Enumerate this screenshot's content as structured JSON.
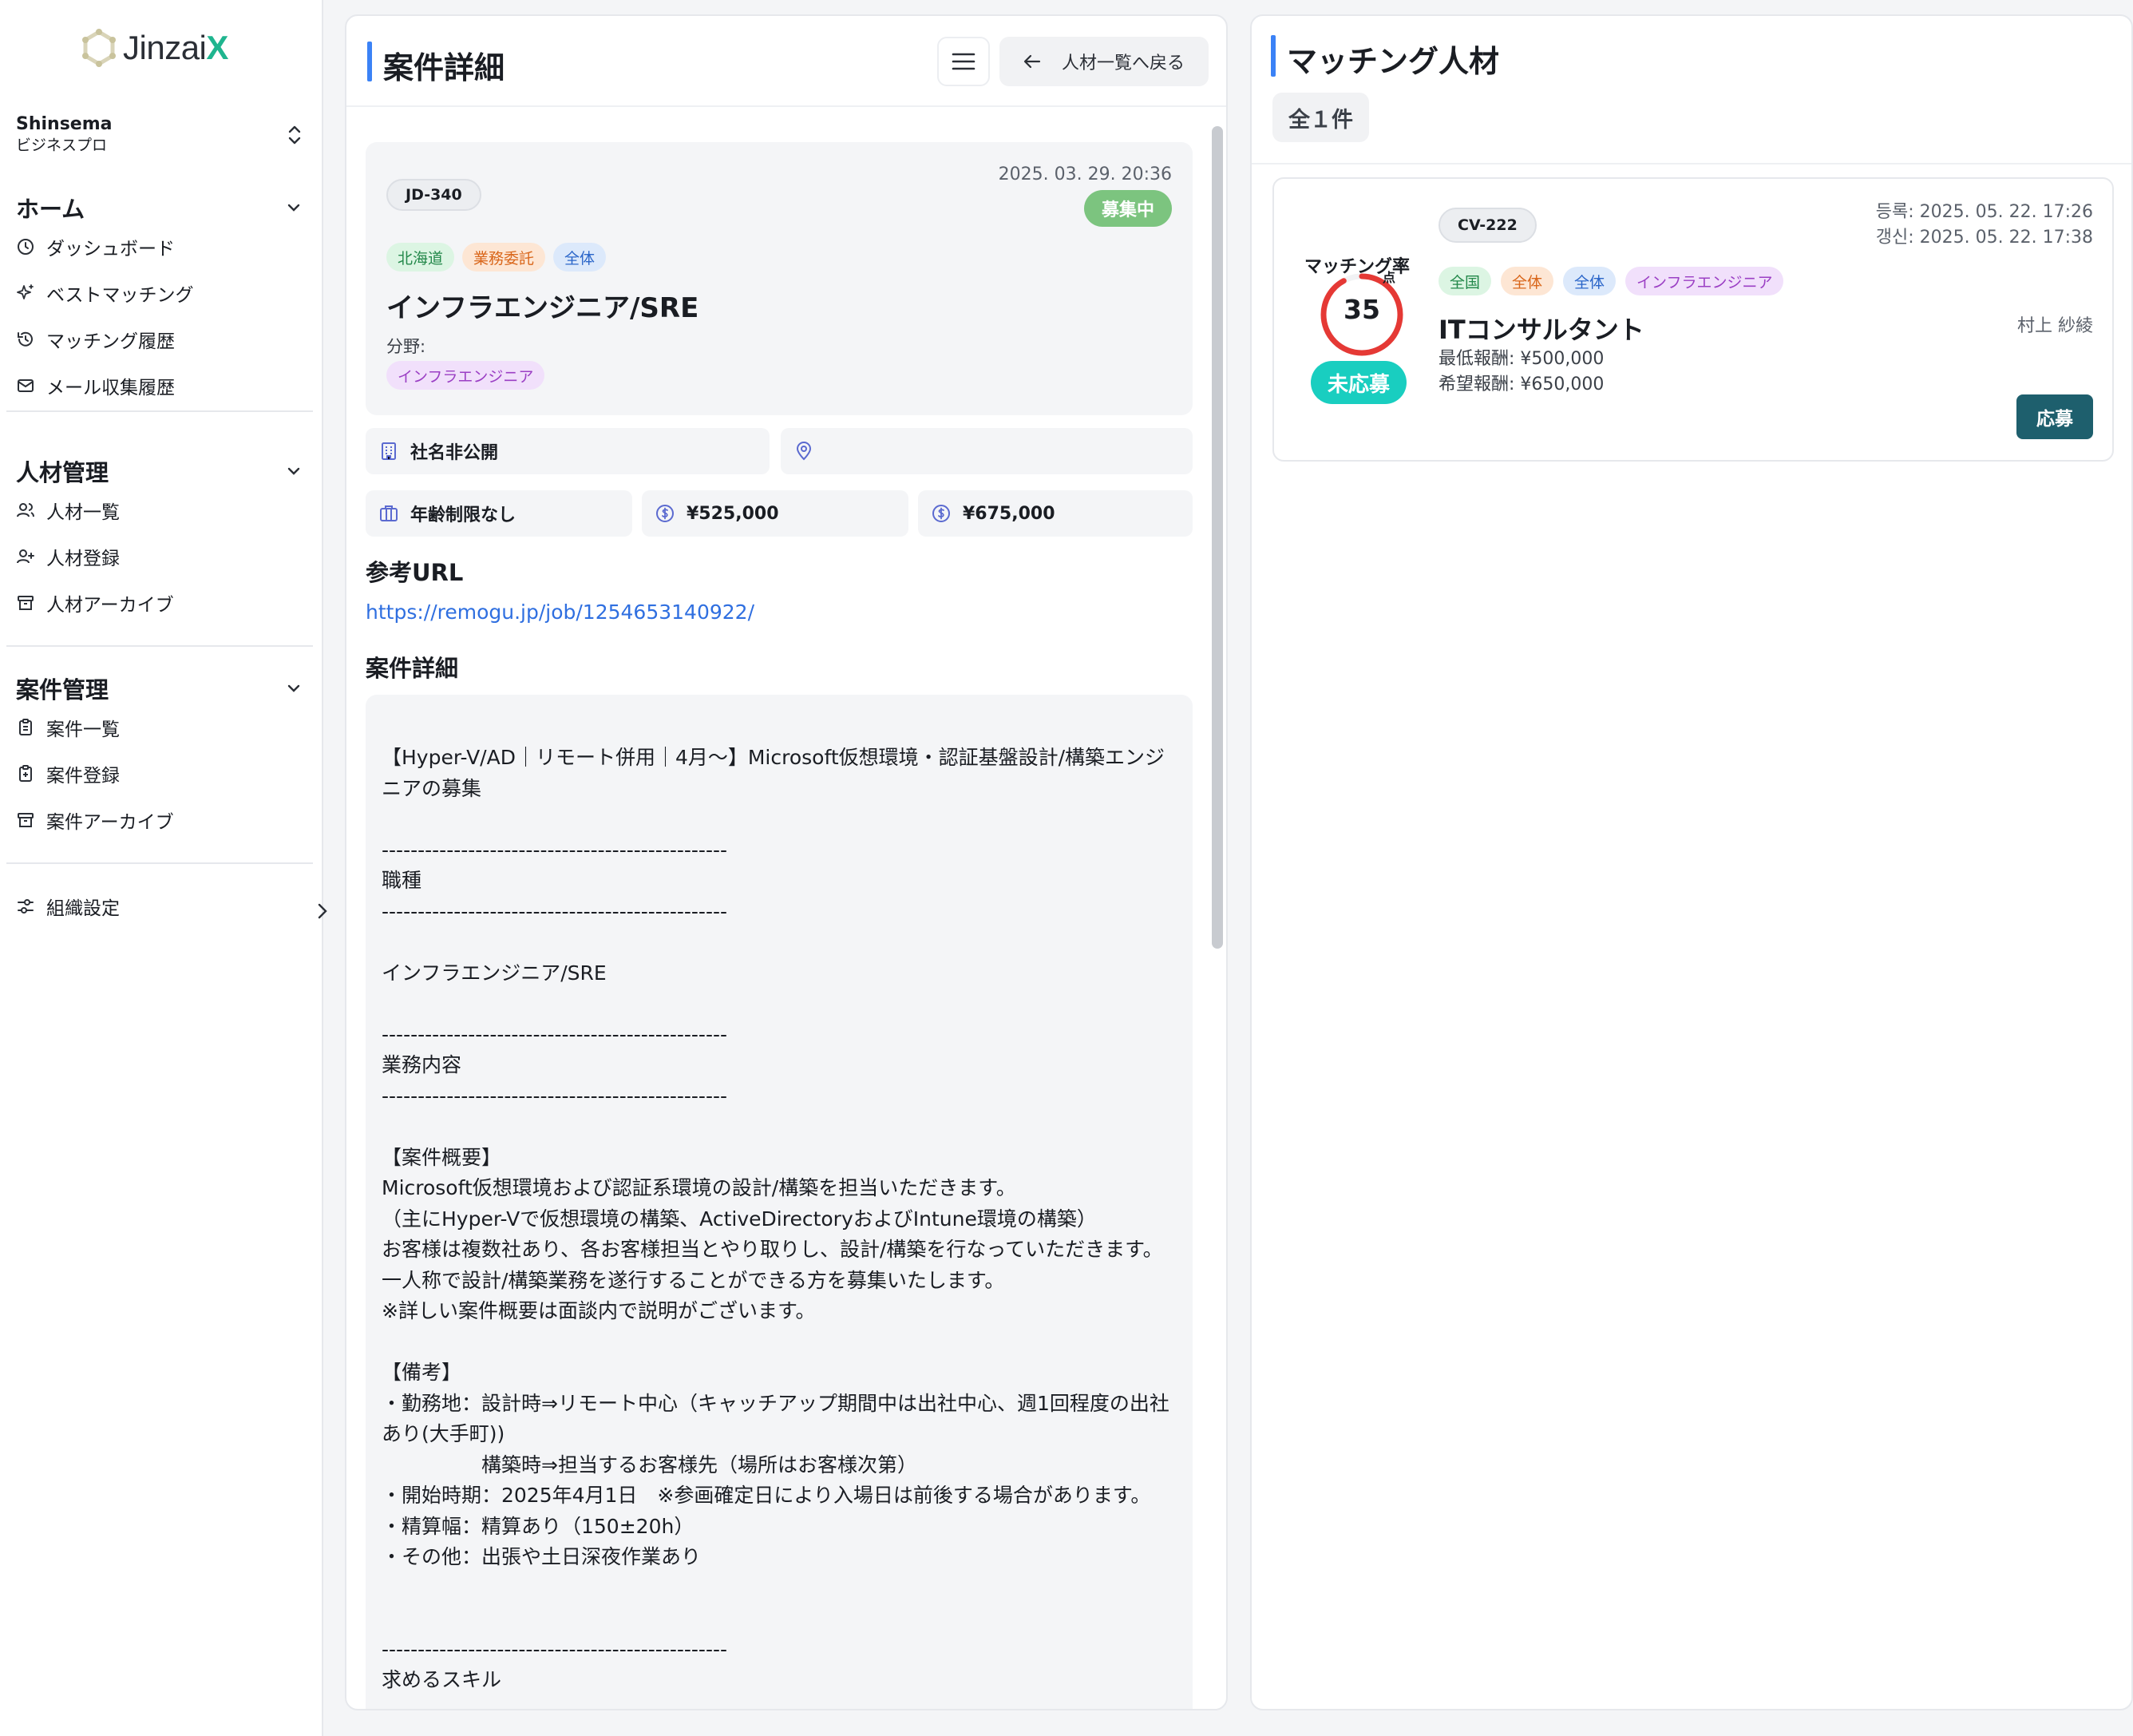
{
  "brand": {
    "name_main": "Jinzai",
    "name_accent": "X"
  },
  "org": {
    "name": "Shinsema",
    "plan": "ビジネスプロ"
  },
  "nav": {
    "home": {
      "label": "ホーム",
      "items": [
        {
          "label": "ダッシュボード",
          "icon": "clock-icon"
        },
        {
          "label": "ベストマッチング",
          "icon": "sparkles-icon"
        },
        {
          "label": "マッチング履歴",
          "icon": "history-icon"
        },
        {
          "label": "メール収集履歴",
          "icon": "mail-icon"
        }
      ]
    },
    "talent": {
      "label": "人材管理",
      "items": [
        {
          "label": "人材一覧",
          "icon": "users-icon"
        },
        {
          "label": "人材登録",
          "icon": "user-plus-icon"
        },
        {
          "label": "人材アーカイブ",
          "icon": "archive-icon"
        }
      ]
    },
    "projects": {
      "label": "案件管理",
      "items": [
        {
          "label": "案件一覧",
          "icon": "clipboard-list-icon"
        },
        {
          "label": "案件登録",
          "icon": "clipboard-plus-icon"
        },
        {
          "label": "案件アーカイブ",
          "icon": "archive-icon"
        }
      ]
    },
    "settings": {
      "label": "組織設定",
      "icon": "sliders-icon"
    }
  },
  "detail": {
    "title": "案件詳細",
    "back_label": "人材一覧へ戻る",
    "job": {
      "code": "JD-340",
      "date": "2025. 03. 29. 20:36",
      "status": "募集中",
      "tags": [
        "北海道",
        "業務委託",
        "全体"
      ],
      "title": "インフラエンジニア/SRE",
      "field_label": "分野:",
      "field_value": "インフラエンジニア"
    },
    "company": "社名非公開",
    "location": "",
    "age": "年齢制限なし",
    "salary_min": "¥525,000",
    "salary_max": "¥675,000",
    "ref_url_title": "参考URL",
    "ref_url": "https://remogu.jp/job/1254653140922/",
    "desc_title": "案件詳細",
    "description": "【Hyper-V/AD｜リモート併用｜4月〜】Microsoft仮想環境・認証基盤設計/構築エンジニアの募集\n\n------------------------------------------------\n職種\n------------------------------------------------\n\nインフラエンジニア/SRE\n\n------------------------------------------------\n業務内容\n------------------------------------------------\n\n【案件概要】\nMicrosoft仮想環境および認証系環境の設計/構築を担当いただきます。\n（主にHyper-Vで仮想環境の構築、ActiveDirectoryおよびIntune環境の構築）\nお客様は複数社あり、各お客様担当とやり取りし、設計/構築を行なっていただきます。\n一人称で設計/構築業務を遂行することができる方を募集いたします。\n※詳しい案件概要は面談内で説明がございます。\n\n【備考】\n・勤務地：設計時⇒リモート中心（キャッチアップ期間中は出社中心、週1回程度の出社あり(大手町))\n　　　　　構築時⇒担当するお客様先（場所はお客様次第）\n・開始時期：2025年4月1日　※参画確定日により入場日は前後する場合があります。\n・精算幅：精算あり（150±20h）\n・その他：出張や土日深夜作業あり\n\n\n------------------------------------------------\n求めるスキル"
  },
  "matching": {
    "title": "マッチング人材",
    "count_label": "全１件",
    "card": {
      "rate_label": "マッチング率",
      "rate": 35,
      "rate_unit": "点",
      "status": "未応募",
      "code": "CV-222",
      "registered": "등록: 2025. 05. 22. 17:26",
      "updated": "갱신: 2025. 05. 22. 17:38",
      "tags": [
        "全国",
        "全体",
        "全体",
        "インフラエンジニア"
      ],
      "title": "ITコンサルタント",
      "person": "村上 紗綾",
      "min_pay": "最低報酬: ¥500,000",
      "desired_pay": "希望報酬: ¥650,000",
      "apply_label": "応募"
    }
  },
  "colors": {
    "accent": "#3b82f6",
    "status_open": "#7cc47f",
    "unapplied": "#19cec0",
    "apply": "#1e5f6d",
    "ring": "#e53935"
  }
}
